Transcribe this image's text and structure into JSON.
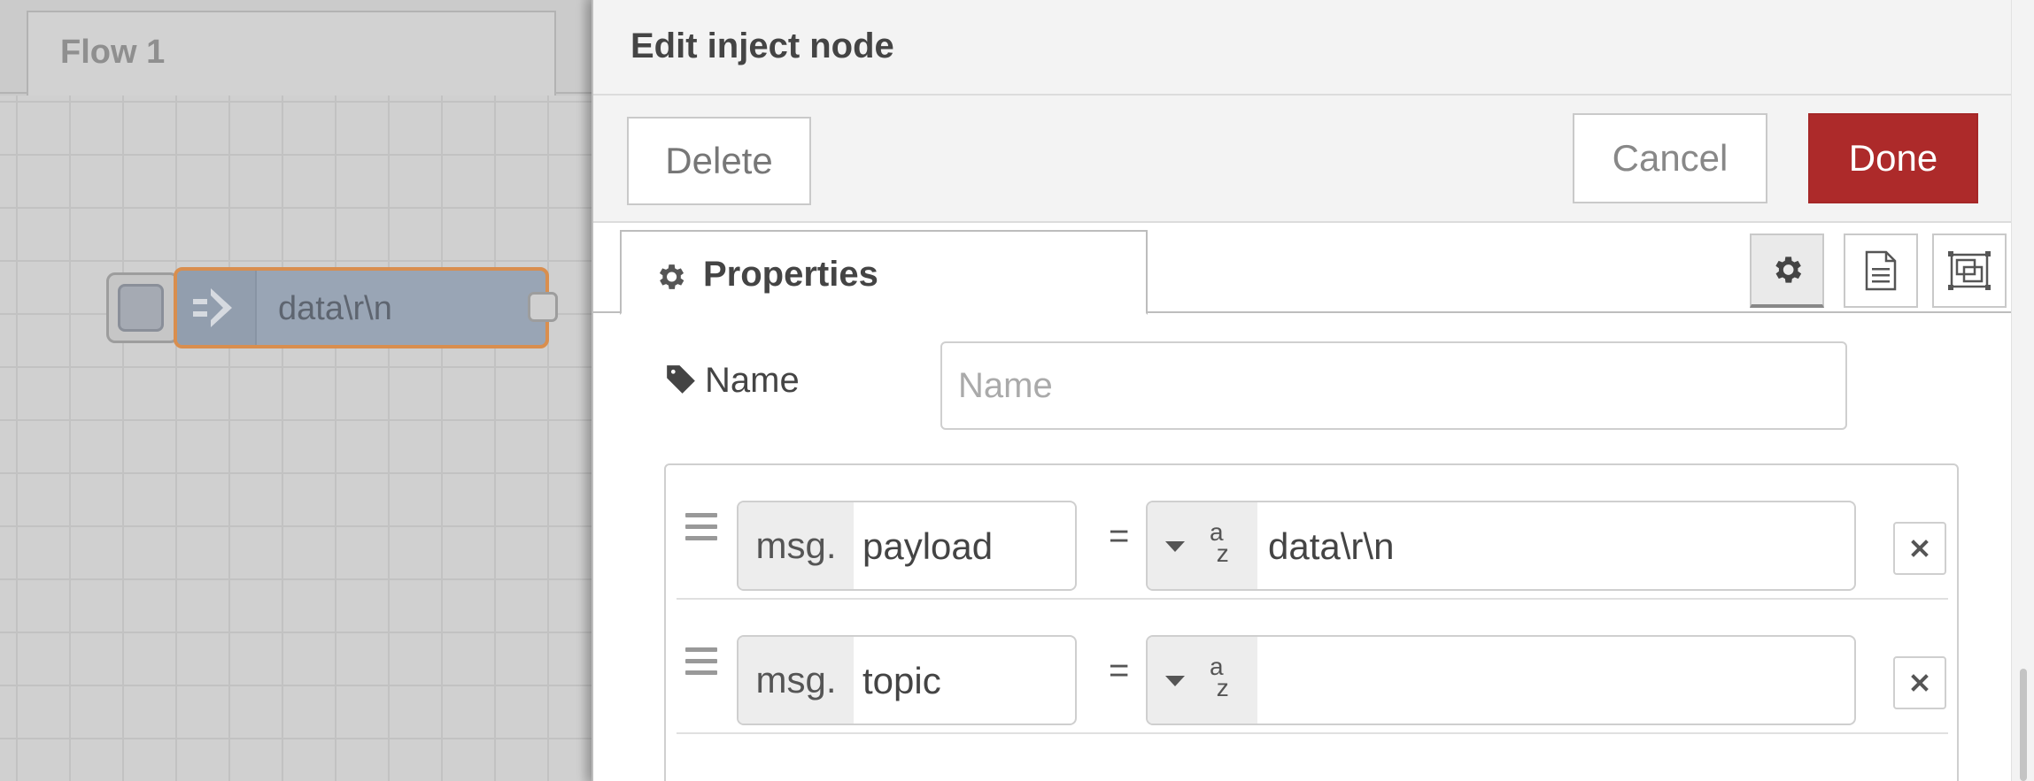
{
  "workspace": {
    "flow_tab_label": "Flow 1",
    "node": {
      "label": "data\\r\\n",
      "type_icon": "inject-arrow-icon"
    }
  },
  "tray": {
    "title": "Edit inject node",
    "delete_label": "Delete",
    "cancel_label": "Cancel",
    "done_label": "Done",
    "properties_tab_label": "Properties",
    "name_label": "Name",
    "name_placeholder": "Name",
    "name_value": "",
    "props": [
      {
        "prefix": "msg.",
        "key": "payload",
        "equals": "=",
        "type_icon": "az-string-icon",
        "value": "data\\r\\n"
      },
      {
        "prefix": "msg.",
        "key": "topic",
        "equals": "=",
        "type_icon": "az-string-icon",
        "value": ""
      }
    ]
  },
  "colors": {
    "done_button": "#ad2a2a",
    "node_body": "#99a5b5",
    "node_selected_border": "#d98e4e"
  }
}
